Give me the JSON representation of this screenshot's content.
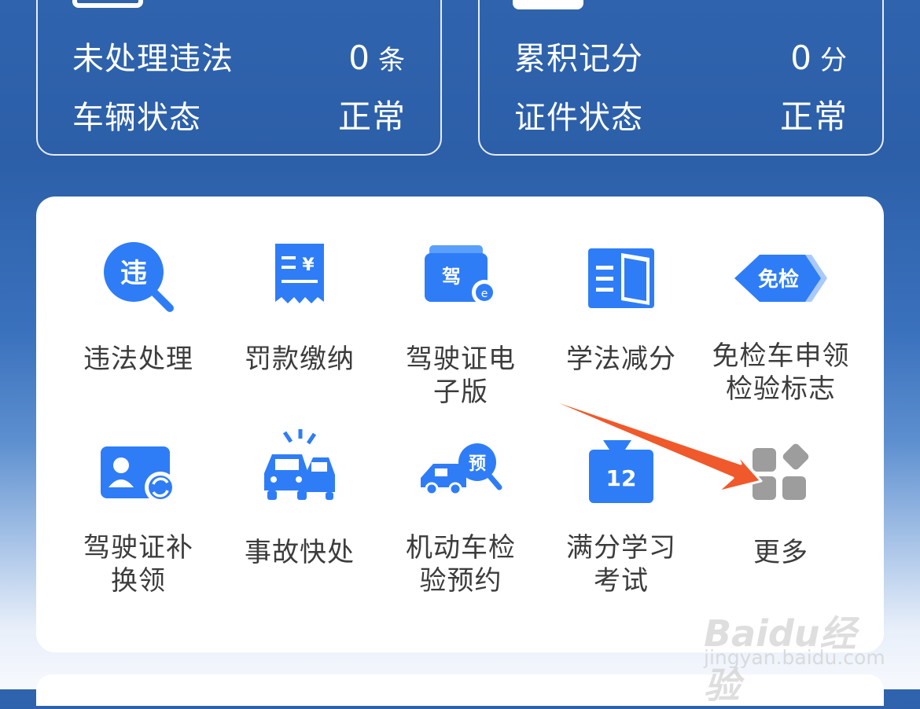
{
  "summary": {
    "left": [
      {
        "label": "未处理违法",
        "value": "0",
        "unit": "条"
      },
      {
        "label": "车辆状态",
        "value": "正常",
        "unit": ""
      }
    ],
    "right": [
      {
        "label": "累积记分",
        "value": "0",
        "unit": "分"
      },
      {
        "label": "证件状态",
        "value": "正常",
        "unit": ""
      }
    ]
  },
  "services": [
    {
      "label": "违法处理",
      "icon": "violation-magnifier-icon",
      "badge": "违"
    },
    {
      "label": "罚款缴纳",
      "icon": "fine-receipt-icon",
      "badge": "¥"
    },
    {
      "label": "驾驶证电子版",
      "icon": "e-license-icon",
      "badge": "驾"
    },
    {
      "label": "学法减分",
      "icon": "book-icon",
      "badge": ""
    },
    {
      "label": "免检车申领检验标志",
      "icon": "exemption-badge-icon",
      "badge": "免检"
    },
    {
      "label": "驾驶证补换领",
      "icon": "license-renew-icon",
      "badge": ""
    },
    {
      "label": "事故快处",
      "icon": "car-accident-icon",
      "badge": ""
    },
    {
      "label": "机动车检验预约",
      "icon": "inspection-appointment-icon",
      "badge": "预"
    },
    {
      "label": "满分学习考试",
      "icon": "calendar-exam-icon",
      "badge": "12"
    },
    {
      "label": "更多",
      "icon": "more-grid-icon",
      "badge": ""
    }
  ],
  "services_lines": [
    [
      "违法处理"
    ],
    [
      "罚款缴纳"
    ],
    [
      "驾驶证电",
      "子版"
    ],
    [
      "学法减分"
    ],
    [
      "免检车申领",
      "检验标志"
    ],
    [
      "驾驶证补",
      "换领"
    ],
    [
      "事故快处"
    ],
    [
      "机动车检",
      "验预约"
    ],
    [
      "满分学习",
      "考试"
    ],
    [
      "更多"
    ]
  ],
  "watermark": {
    "brand": "Baidu经验",
    "url": "jingyan.baidu.com"
  },
  "colors": {
    "primary_blue": "#2f7df6",
    "header_bg": "#2f63ad",
    "arrow": "#f0592b",
    "more_gray": "#9d9d9d"
  }
}
